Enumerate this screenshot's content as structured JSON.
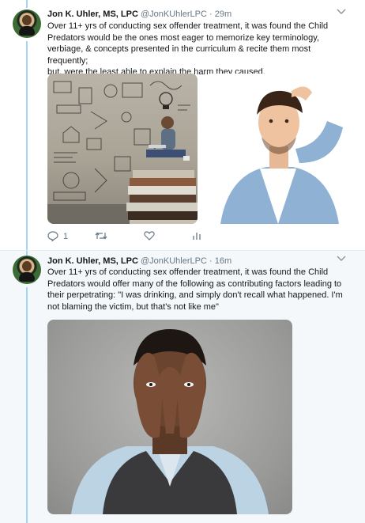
{
  "tweets": [
    {
      "author_name": "Jon K. Uhler, MS, LPC",
      "handle": "@JonKUhlerLPC",
      "separator": "·",
      "time": "29m",
      "lines": [
        "Over 11+ yrs of conducting sex offender treatment, it was found the Child",
        "Predators would be the ones most eager to memorize key terminology,",
        "verbiage, & concepts presented in the curriculum & recite them most frequently;",
        "but, were the least able to explain the harm they caused."
      ],
      "reply_count": "1"
    },
    {
      "author_name": "Jon K. Uhler, MS, LPC",
      "handle": "@JonKUhlerLPC",
      "separator": "·",
      "time": "16m",
      "lines": [
        "Over 11+ yrs of conducting sex offender treatment, it was found the Child",
        "Predators would offer many of the following as contributing factors leading to",
        "their perpetrating: \"I was drinking, and simply don't recall what happened. I'm",
        "not blaming the victim, but that's not like me\""
      ]
    }
  ],
  "icons": {
    "reply": "reply-icon",
    "retweet": "retweet-icon",
    "like": "heart-icon",
    "analytics": "analytics-icon",
    "menu": "chevron-down-icon"
  },
  "colors": {
    "thread_line": "#a8d4f2",
    "second_tweet_bg": "#f5f8fa",
    "secondary_text": "#657786"
  }
}
